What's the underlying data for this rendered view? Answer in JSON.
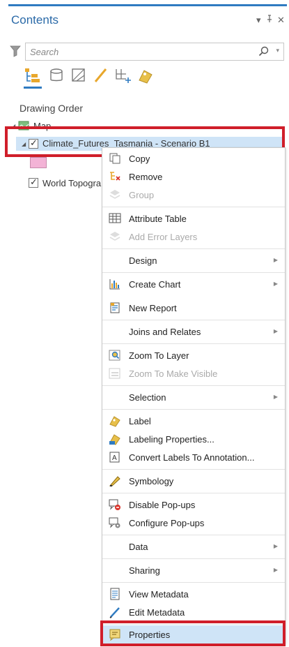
{
  "pane": {
    "title": "Contents",
    "pin_glyph": "▾ ⊥ ×"
  },
  "search": {
    "placeholder": "Search"
  },
  "view_tabs": [
    {
      "icon": "list-by-drawing-order-icon"
    },
    {
      "icon": "list-by-source-icon"
    },
    {
      "icon": "list-by-selection-icon"
    },
    {
      "icon": "list-by-editing-icon"
    },
    {
      "icon": "list-by-snapping-icon"
    },
    {
      "icon": "list-by-labeling-icon"
    }
  ],
  "section_label": "Drawing Order",
  "tree": {
    "map": "Map",
    "layer": "Climate_Futures_Tasmania - Scenario B1",
    "basemap": "World Topographic Map"
  },
  "menu": [
    {
      "label": "Copy",
      "icon": "copy-icon",
      "enabled": true
    },
    {
      "label": "Remove",
      "icon": "remove-icon",
      "enabled": true
    },
    {
      "label": "Group",
      "icon": "group-icon",
      "enabled": false
    },
    {
      "label": "Attribute Table",
      "icon": "attribute-table-icon",
      "enabled": true
    },
    {
      "label": "Add Error Layers",
      "icon": "add-error-layers-icon",
      "enabled": false
    },
    {
      "label": "Design",
      "enabled": true,
      "submenu": true
    },
    {
      "label": "Create Chart",
      "icon": "create-chart-icon",
      "enabled": true,
      "submenu": true
    },
    {
      "label": "New Report",
      "icon": "new-report-icon",
      "enabled": true
    },
    {
      "label": "Joins and Relates",
      "enabled": true,
      "submenu": true
    },
    {
      "label": "Zoom To Layer",
      "icon": "zoom-to-layer-icon",
      "enabled": true
    },
    {
      "label": "Zoom To Make Visible",
      "icon": "zoom-to-make-visible-icon",
      "enabled": false
    },
    {
      "label": "Selection",
      "enabled": true,
      "submenu": true
    },
    {
      "label": "Label",
      "icon": "label-icon",
      "enabled": true
    },
    {
      "label": "Labeling Properties...",
      "icon": "labeling-properties-icon",
      "enabled": true
    },
    {
      "label": "Convert Labels To Annotation...",
      "icon": "convert-labels-icon",
      "enabled": true
    },
    {
      "label": "Symbology",
      "icon": "symbology-icon",
      "enabled": true
    },
    {
      "label": "Disable Pop-ups",
      "icon": "disable-popups-icon",
      "enabled": true
    },
    {
      "label": "Configure Pop-ups",
      "icon": "configure-popups-icon",
      "enabled": true
    },
    {
      "label": "Data",
      "enabled": true,
      "submenu": true
    },
    {
      "label": "Sharing",
      "enabled": true,
      "submenu": true
    },
    {
      "label": "View Metadata",
      "icon": "view-metadata-icon",
      "enabled": true
    },
    {
      "label": "Edit Metadata",
      "icon": "edit-metadata-icon",
      "enabled": true
    },
    {
      "label": "Properties",
      "icon": "properties-icon",
      "enabled": true,
      "highlight": true
    }
  ],
  "colors": {
    "accent": "#2f7bc1",
    "selection": "#cfe4f7",
    "highlight_box": "#d01e2a",
    "layer_swatch": "#f3b3d6"
  }
}
